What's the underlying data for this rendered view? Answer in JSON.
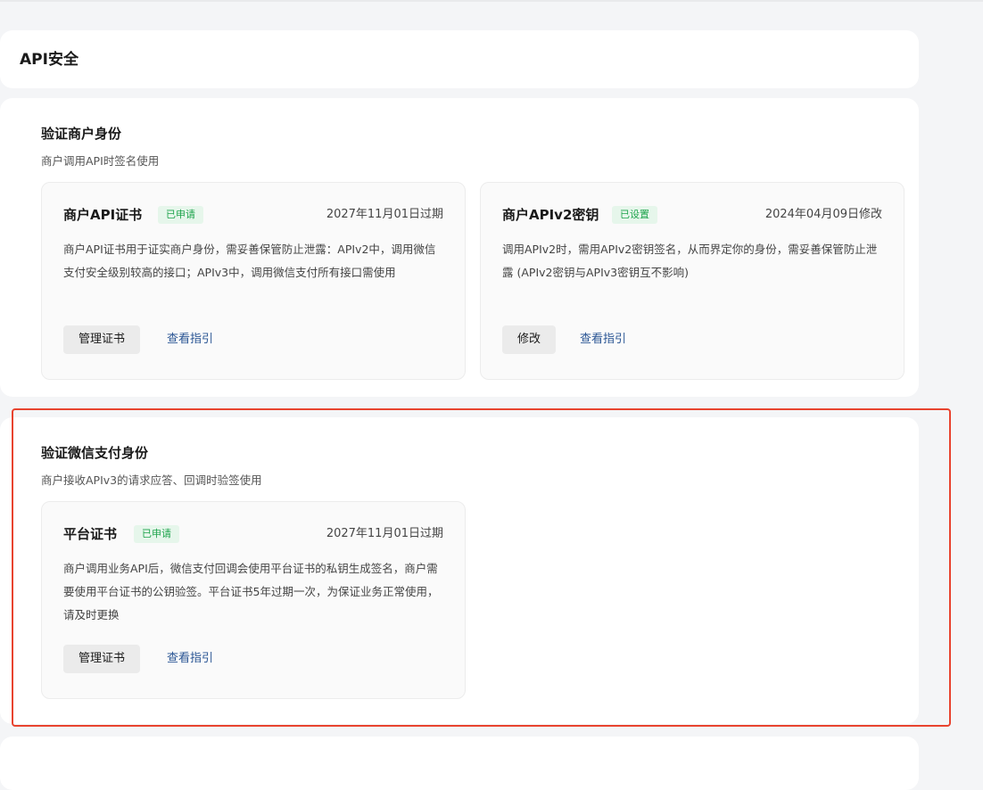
{
  "page": {
    "title": "API安全"
  },
  "sections": [
    {
      "title": "验证商户身份",
      "desc": "商户调用API时签名使用",
      "cards": [
        {
          "title": "商户API证书",
          "badge": "已申请",
          "date": "2027年11月01日过期",
          "desc": "商户API证书用于证实商户身份，需妥善保管防止泄露：APIv2中，调用微信支付安全级别较高的接口；APIv3中，调用微信支付所有接口需使用",
          "primary_button": "管理证书",
          "link": "查看指引"
        },
        {
          "title": "商户APIv2密钥",
          "badge": "已设置",
          "date": "2024年04月09日修改",
          "desc": "调用APIv2时，需用APIv2密钥签名，从而界定你的身份，需妥善保管防止泄露 (APIv2密钥与APIv3密钥互不影响)",
          "primary_button": "修改",
          "link": "查看指引"
        }
      ]
    },
    {
      "title": "验证微信支付身份",
      "desc": "商户接收APIv3的请求应答、回调时验签使用",
      "cards": [
        {
          "title": "平台证书",
          "badge": "已申请",
          "date": "2027年11月01日过期",
          "desc": "商户调用业务API后，微信支付回调会使用平台证书的私钥生成签名，商户需要使用平台证书的公钥验签。平台证书5年过期一次，为保证业务正常使用，请及时更换",
          "primary_button": "管理证书",
          "link": "查看指引"
        }
      ]
    }
  ],
  "colors": {
    "background": "#f4f5f7",
    "panel": "#ffffff",
    "card": "#fafafa",
    "badge_text": "#1fa44d",
    "badge_bg": "#e6f6eb",
    "link": "#2a5594",
    "highlight": "#e8432f"
  }
}
